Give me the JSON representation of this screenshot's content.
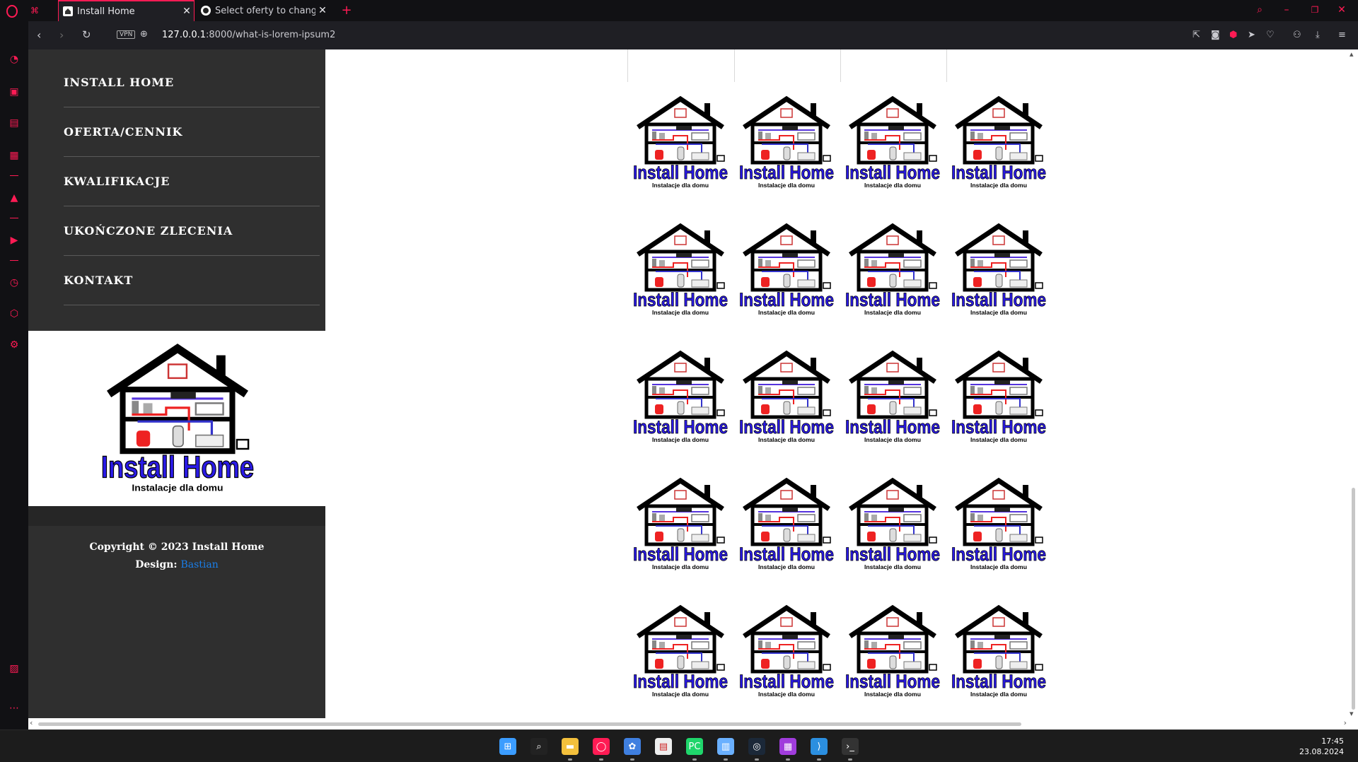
{
  "browser": {
    "tabs": [
      {
        "title": "Install Home",
        "active": true
      },
      {
        "title": "Select oferty to change | Dj",
        "active": false
      }
    ],
    "new_tab_label": "+",
    "url_host": "127.0.0.1",
    "url_path": ":8000/what-is-lorem-ipsum2",
    "vpn_badge": "VPN",
    "accent_color": "#ff1b54"
  },
  "site": {
    "nav_items": [
      "INSTALL HOME",
      "OFERTA/CENNIK",
      "KWALIFIKACJE",
      "UKOŃCZONE ZLECENIA",
      "KONTAKT"
    ],
    "logo": {
      "brand": "Install Home",
      "tagline": "Instalacje dla domu"
    },
    "footer": {
      "copyright": "Copyright © 2023 Install Home",
      "design_label": "Design:",
      "design_link": "Bastian"
    },
    "gallery": {
      "rows": 5,
      "columns": 4,
      "item_brand": "Install Home",
      "item_tagline": "Instalacje dla domu"
    }
  },
  "taskbar": {
    "icons": [
      "windows-start-icon",
      "search-icon",
      "file-explorer-icon",
      "opera-icon",
      "app-icon",
      "notepad-icon",
      "pycharm-icon",
      "notes-icon",
      "steam-icon",
      "winrar-icon",
      "vscode-icon",
      "terminal-icon"
    ],
    "time": "17:45",
    "date": "23.08.2024"
  }
}
